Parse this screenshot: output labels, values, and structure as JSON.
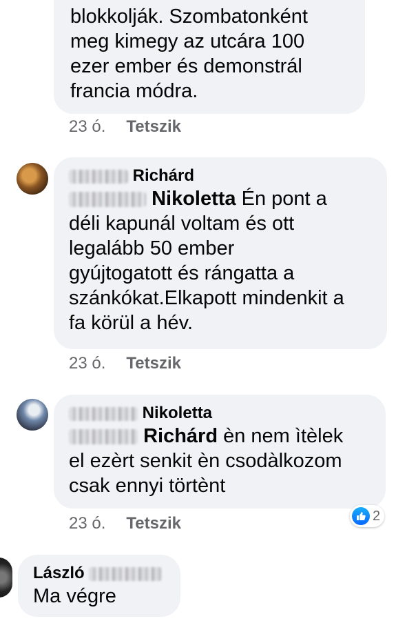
{
  "comments": [
    {
      "lines": [
        "blokkolják. Szombatonként",
        "meg kimegy az utcára 100",
        "ezer ember és demonstrál",
        "francia módra."
      ],
      "time": "23 ó.",
      "like_label": "Tetszik"
    },
    {
      "author_visible": "Richárd",
      "mention_visible": "Nikoletta",
      "first_line_rest": " Én pont a",
      "lines": [
        "déli kapunál voltam és ott",
        "legalább 50 ember",
        "gyújtogatott és rángatta a",
        "szánkókat.Elkapott mindenkit a",
        "fa körül a hév."
      ],
      "time": "23 ó.",
      "like_label": "Tetszik"
    },
    {
      "author_visible": "Nikoletta",
      "mention_visible": "Richárd",
      "first_line_rest": " èn nem ìtèlek",
      "lines": [
        "el ezèrt senkit èn csodàlkozom",
        "csak ennyi törtènt"
      ],
      "time": "23 ó.",
      "like_label": "Tetszik",
      "reaction_count": "2"
    },
    {
      "author_visible": "László",
      "lines": [
        "Ma végre"
      ]
    }
  ],
  "colors": {
    "bubble": "#f0f2f5",
    "meta": "#65676b",
    "like_blue": "#0866ff"
  }
}
